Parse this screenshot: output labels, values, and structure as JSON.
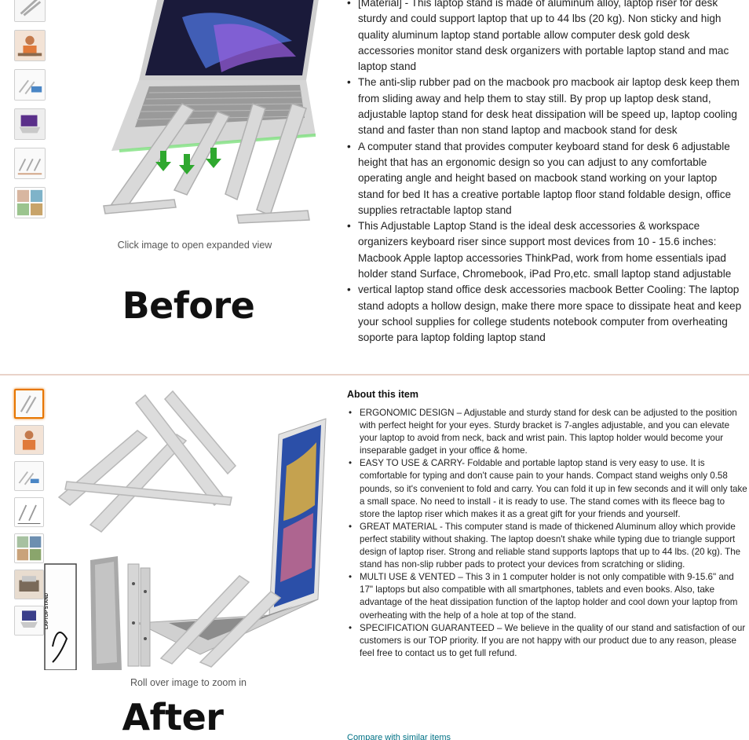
{
  "before": {
    "label": "Before",
    "caption": "Click image to open expanded view",
    "bullets": [
      "[Material] - This laptop stand is made of aluminum alloy, laptop riser for desk sturdy and could support laptop that up to 44 lbs (20 kg). Non sticky and high quality aluminum laptop stand portable allow computer desk gold desk accessories monitor stand desk organizers with portable laptop stand and mac laptop stand",
      "The anti-slip rubber pad on the macbook pro macbook air laptop desk keep them from sliding away and help them to stay still. By prop up laptop desk stand, adjustable laptop stand for desk heat dissipation will be speed up, laptop cooling stand and faster than non stand laptop and macbook stand for desk",
      "A computer stand that provides computer keyboard stand for desk 6 adjustable height that has an ergonomic design so you can adjust to any comfortable operating angle and height based on macbook stand working on your laptop stand for bed It has a creative portable laptop floor stand foldable design, office supplies retractable laptop stand",
      "This Adjustable Laptop Stand is the ideal desk accessories & workspace organizers keyboard riser since support most devices from 10 - 15.6 inches: Macbook Apple laptop accessories ThinkPad, work from home essentials ipad holder stand Surface, Chromebook, iPad Pro,etc. small laptop stand adjustable",
      "vertical laptop stand office desk accessories macbook Better Cooling: The laptop stand adopts a hollow design, make there more space to dissipate heat and keep your school supplies for college students notebook computer from overheating soporte para laptop folding laptop stand"
    ]
  },
  "after": {
    "label": "After",
    "caption": "Roll over image to zoom in",
    "about_title": "About this item",
    "compare_link": "Compare with similar items",
    "bullets": [
      "ERGONOMIC DESIGN – Adjustable and sturdy stand for desk can be adjusted to the position with perfect height for your eyes. Sturdy bracket is 7-angles adjustable, and you can elevate your laptop to avoid from neck, back and wrist pain. This laptop holder would become your inseparable gadget in your office & home.",
      "EASY TO USE & CARRY- Foldable and portable laptop stand is very easy to use. It is comfortable for typing and don't cause pain to your hands. Compact stand weighs only 0.58 pounds, so it's convenient to fold and carry. You can fold it up in few seconds and it will only take a small space. No need to install - it is ready to use. The stand comes with its fleece bag to store the laptop riser which makes it as a great gift for your friends and yourself.",
      "GREAT MATERIAL - This computer stand is made of thickened Aluminum alloy which provide perfect stability without shaking. The laptop doesn't shake while typing due to triangle support design of laptop riser. Strong and reliable stand supports laptops that up to 44 lbs. (20 kg). The stand has non-slip rubber pads to protect your devices from scratching or sliding.",
      "MULTI USE & VENTED – This 3 in 1 computer holder is not only compatible with 9-15.6\" and 17\" laptops but also compatible with all smartphones, tablets and even books. Also, take advantage of the heat dissipation function of the laptop holder and cool down your laptop from overheating with the help of a hole at top of the stand.",
      "SPECIFICATION GUARANTEED – We believe in the quality of our stand and satisfaction of our customers is our TOP priority. If you are not happy with our product due to any reason, please feel free to contact us to get full refund."
    ],
    "package_text": "LAPTOP STAND"
  },
  "colors": {
    "active_thumb_border": "#e77600",
    "link": "#007185",
    "divider": "#e9d3c9"
  }
}
